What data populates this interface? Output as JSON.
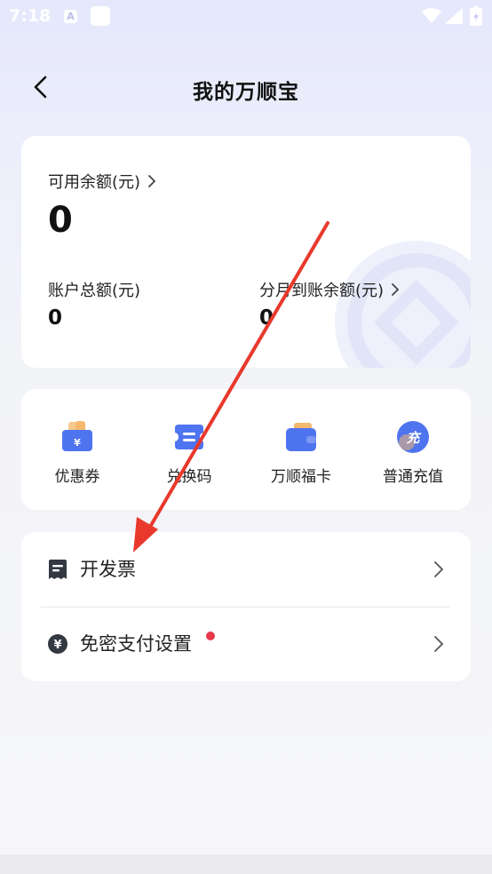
{
  "status_bar": {
    "time": "7:18",
    "app_icon_letter": "A"
  },
  "header": {
    "title": "我的万顺宝",
    "back_icon": "chevron-left-icon"
  },
  "balance": {
    "available_label": "可用余额(元)",
    "available_value": "0",
    "total_label": "账户总额(元)",
    "total_value": "0",
    "installment_label": "分月到账余额(元)",
    "installment_value": "0"
  },
  "quick_actions": [
    {
      "label": "优惠券",
      "icon": "coupon-icon"
    },
    {
      "label": "兑换码",
      "icon": "ticket-icon"
    },
    {
      "label": "万顺福卡",
      "icon": "wallet-card-icon"
    },
    {
      "label": "普通充值",
      "icon": "recharge-icon",
      "icon_text": "充"
    }
  ],
  "menu": [
    {
      "label": "开发票",
      "icon": "invoice-icon"
    },
    {
      "label": "免密支付设置",
      "icon": "yuan-icon",
      "has_badge": true
    }
  ],
  "colors": {
    "accent_blue": "#4f74f0",
    "badge_red": "#e8394d",
    "annotation_red": "#e8392c",
    "icon_dark": "#333842"
  }
}
